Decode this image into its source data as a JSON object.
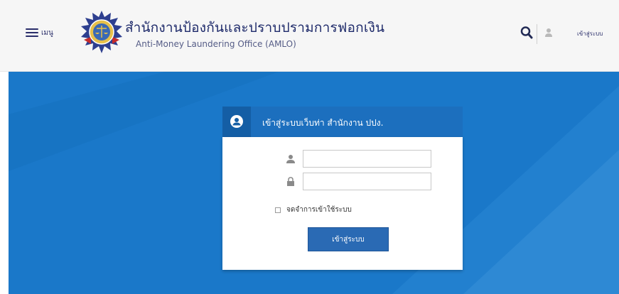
{
  "header": {
    "menu_label": "เมนู",
    "org_name_th": "สำนักงานป้องกันและปราบปรามการฟอกเงิน",
    "org_name_en": "Anti-Money Laundering Office (AMLO)",
    "login_link": "เข้าสู่ระบบ"
  },
  "login": {
    "title": "เข้าสู่ระบบเว็บท่า สำนักงาน ปปง.",
    "username_value": "",
    "password_value": "",
    "remember_label": "จดจำการเข้าใช้ระบบ",
    "submit_label": "เข้าสู่ระบบ"
  },
  "icons": {
    "menu": "hamburger-icon",
    "logo": "amlo-emblem",
    "search": "search-icon",
    "user": "user-icon",
    "lock": "lock-icon"
  },
  "colors": {
    "brand_blue": "#1a78c9",
    "header_bg": "#f6f6f6",
    "title_text": "#1e2a6a",
    "button": "#2a6ab4"
  }
}
